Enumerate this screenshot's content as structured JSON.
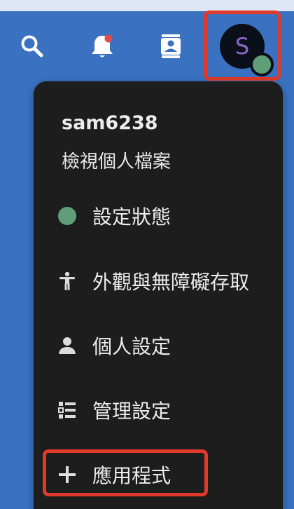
{
  "topbar": {
    "icons": [
      "search-icon",
      "bell-icon",
      "contacts-icon"
    ],
    "notification_badge_color": "#e14a4a"
  },
  "user": {
    "avatar_initial": "S",
    "username": "sam6238",
    "view_profile": "檢視個人檔案",
    "status_color": "#5e9f78"
  },
  "menu": {
    "items": [
      {
        "label": "設定狀態",
        "icon": "status-dot-icon"
      },
      {
        "label": "外觀與無障礙存取",
        "icon": "accessibility-icon"
      },
      {
        "label": "個人設定",
        "icon": "person-icon"
      },
      {
        "label": "管理設定",
        "icon": "admin-list-icon"
      },
      {
        "label": "應用程式",
        "icon": "plus-icon"
      }
    ]
  },
  "colors": {
    "header_blue": "#3a72c1",
    "menu_bg": "#1d1d1d",
    "highlight_red": "#e13a2a"
  }
}
